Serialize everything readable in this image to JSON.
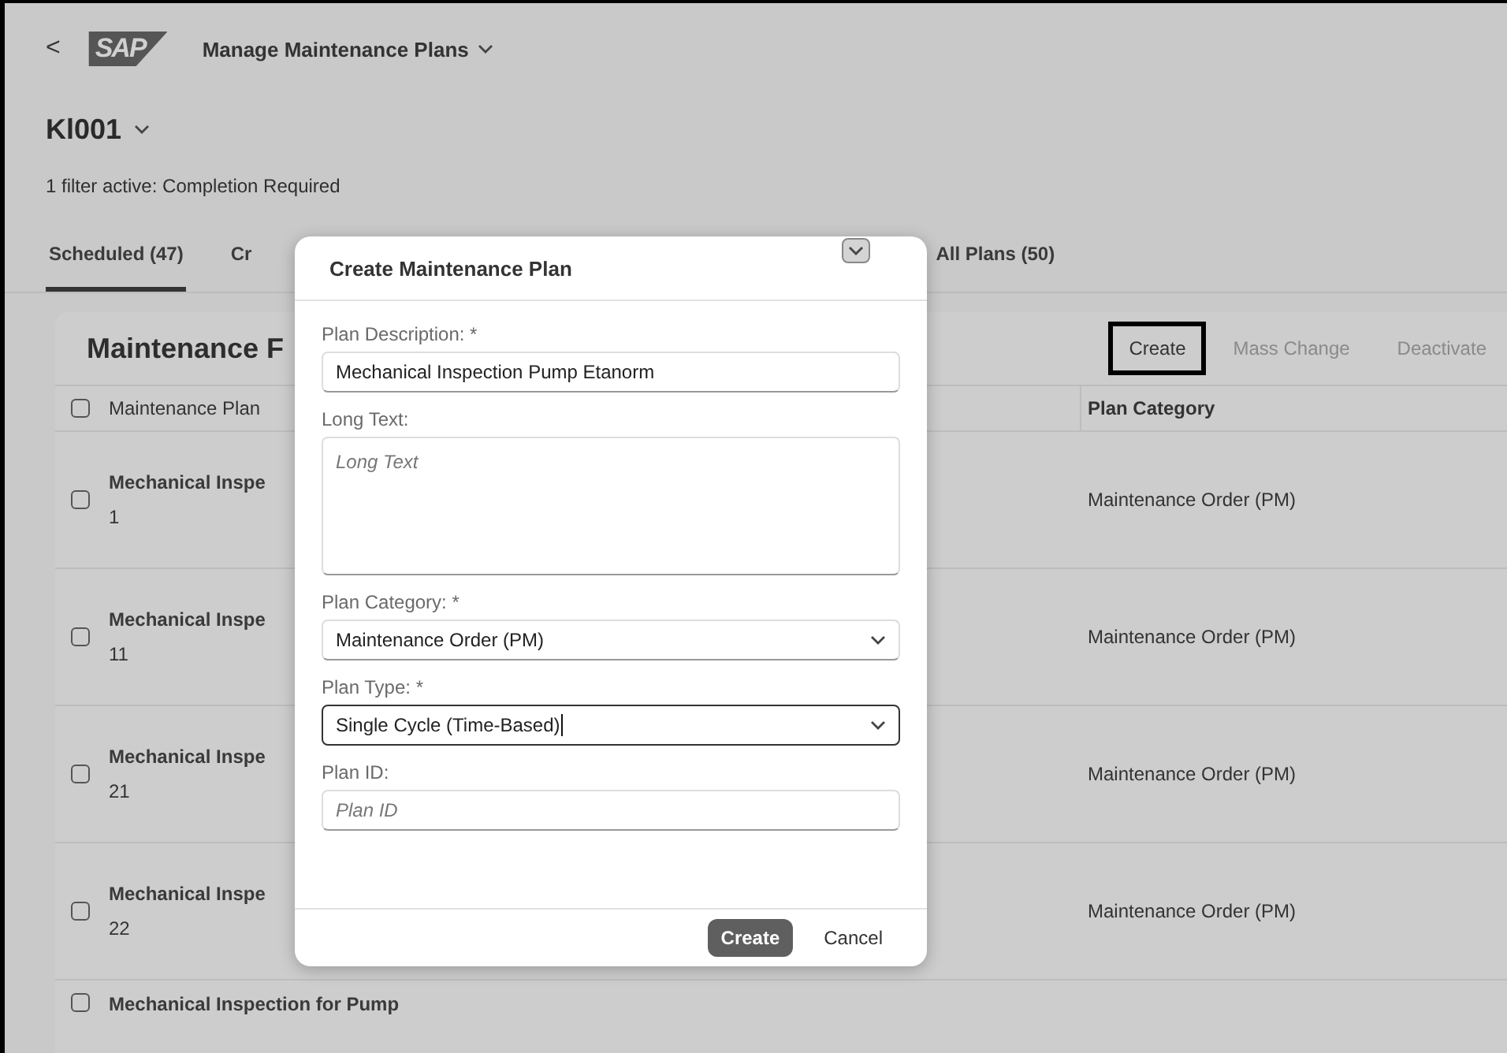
{
  "shell": {
    "back": "<",
    "logo": "SAP",
    "title": "Manage Maintenance Plans"
  },
  "header": {
    "title": "Kl001",
    "filter_text": "1 filter active: Completion Required"
  },
  "tabs": [
    {
      "label": "Scheduled (47)",
      "selected": true
    },
    {
      "label": "Cr",
      "selected": false
    },
    {
      "label": "All Plans (50)",
      "selected": false
    }
  ],
  "table": {
    "title": "Maintenance F",
    "actions": [
      {
        "label": "Create",
        "disabled": false,
        "highlighted": true
      },
      {
        "label": "Mass Change",
        "disabled": true,
        "highlighted": false
      },
      {
        "label": "Deactivate",
        "disabled": true,
        "highlighted": false
      }
    ],
    "select_all_checked": false,
    "columns": [
      "Maintenance Plan",
      "Plan Category"
    ],
    "rows": [
      {
        "title": "Mechanical Inspe",
        "number": "1",
        "category": "Maintenance Order (PM)",
        "checked": false
      },
      {
        "title": "Mechanical Inspe",
        "number": "11",
        "category": "Maintenance Order (PM)",
        "checked": false
      },
      {
        "title": "Mechanical Inspe",
        "number": "21",
        "category": "Maintenance Order (PM)",
        "checked": false
      },
      {
        "title": "Mechanical Inspe",
        "number": "22",
        "category": "Maintenance Order (PM)",
        "checked": false
      },
      {
        "title": "Mechanical Inspection for Pump",
        "checked": false
      }
    ]
  },
  "dialog": {
    "title": "Create Maintenance Plan",
    "fields": [
      {
        "kind": "input",
        "label": "Plan Description:",
        "required": true,
        "value": "Mechanical Inspection Pump Etanorm",
        "focused": false
      },
      {
        "kind": "textarea",
        "label": "Long Text:",
        "required": false,
        "placeholder": "Long Text",
        "focused": false
      },
      {
        "kind": "select",
        "label": "Plan Category:",
        "required": true,
        "value": "Maintenance Order (PM)",
        "focused": false
      },
      {
        "kind": "select",
        "label": "Plan Type:",
        "required": true,
        "value": "Single Cycle (Time-Based)",
        "focused": true
      },
      {
        "kind": "input",
        "label": "Plan ID:",
        "required": false,
        "placeholder": "Plan ID",
        "focused": false
      }
    ],
    "required_mark": "*",
    "buttons": [
      {
        "label": "Create",
        "kind": "primary"
      },
      {
        "label": "Cancel",
        "kind": "secondary"
      }
    ]
  }
}
